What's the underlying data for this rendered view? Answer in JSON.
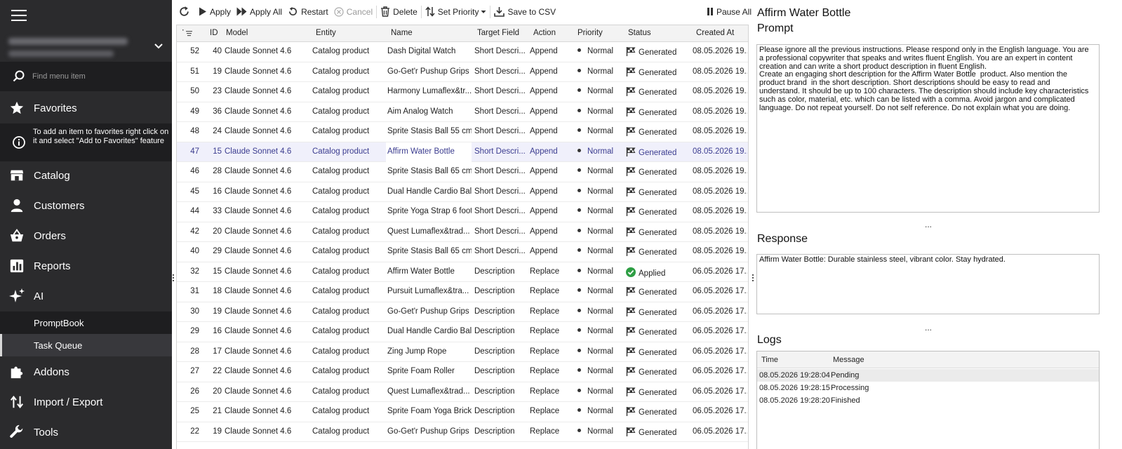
{
  "sidebar": {
    "search_placeholder": "Find menu item",
    "favorites_label": "Favorites",
    "favorites_hint": "To add an item to favorites right click on it and select \"Add to Favorites\" feature",
    "items": [
      {
        "label": "Catalog",
        "icon": "store-icon"
      },
      {
        "label": "Customers",
        "icon": "person-icon"
      },
      {
        "label": "Orders",
        "icon": "basket-icon"
      },
      {
        "label": "Reports",
        "icon": "bar-chart-icon"
      },
      {
        "label": "AI",
        "icon": "sparkle-icon"
      }
    ],
    "ai_subitems": [
      {
        "label": "PromptBook"
      },
      {
        "label": "Task Queue",
        "active": true
      }
    ],
    "bottom_items": [
      {
        "label": "Addons",
        "icon": "puzzle-icon"
      },
      {
        "label": "Import / Export",
        "icon": "import-export-icon"
      },
      {
        "label": "Tools",
        "icon": "wrench-icon"
      }
    ]
  },
  "toolbar": {
    "apply": "Apply",
    "apply_all": "Apply All",
    "restart": "Restart",
    "cancel": "Cancel",
    "delete": "Delete",
    "set_priority": "Set Priority",
    "save_csv": "Save to CSV",
    "pause_all": "Pause All"
  },
  "grid": {
    "columns": [
      "ID",
      "Model",
      "Entity",
      "Name",
      "Target Field",
      "Action",
      "Priority",
      "Status",
      "Created At"
    ],
    "rows": [
      {
        "num": "52",
        "id": "40",
        "model": "Claude Sonnet 4.6",
        "entity": "Catalog product",
        "name": "Dash Digital Watch",
        "field": "Short Descri...",
        "action": "Append",
        "priority": "Normal",
        "status": "Generated",
        "created": "08.05.2026 19..."
      },
      {
        "num": "51",
        "id": "19",
        "model": "Claude Sonnet 4.6",
        "entity": "Catalog product",
        "name": "Go-Get'r Pushup Grips",
        "field": "Short Descri...",
        "action": "Append",
        "priority": "Normal",
        "status": "Generated",
        "created": "08.05.2026 19..."
      },
      {
        "num": "50",
        "id": "23",
        "model": "Claude Sonnet 4.6",
        "entity": "Catalog product",
        "name": "Harmony Lumaflex&tr...",
        "field": "Short Descri...",
        "action": "Append",
        "priority": "Normal",
        "status": "Generated",
        "created": "08.05.2026 19..."
      },
      {
        "num": "49",
        "id": "36",
        "model": "Claude Sonnet 4.6",
        "entity": "Catalog product",
        "name": "Aim Analog Watch",
        "field": "Short Descri...",
        "action": "Append",
        "priority": "Normal",
        "status": "Generated",
        "created": "08.05.2026 19..."
      },
      {
        "num": "48",
        "id": "24",
        "model": "Claude Sonnet 4.6",
        "entity": "Catalog product",
        "name": "Sprite Stasis Ball 55 cm",
        "field": "Short Descri...",
        "action": "Append",
        "priority": "Normal",
        "status": "Generated",
        "created": "08.05.2026 19..."
      },
      {
        "num": "47",
        "id": "15",
        "model": "Claude Sonnet 4.6",
        "entity": "Catalog product",
        "name": "Affirm Water Bottle",
        "field": "Short Descri...",
        "action": "Append",
        "priority": "Normal",
        "status": "Generated",
        "created": "08.05.2026 19...",
        "selected": true
      },
      {
        "num": "46",
        "id": "28",
        "model": "Claude Sonnet 4.6",
        "entity": "Catalog product",
        "name": "Sprite Stasis Ball 65 cm",
        "field": "Short Descri...",
        "action": "Append",
        "priority": "Normal",
        "status": "Generated",
        "created": "08.05.2026 19..."
      },
      {
        "num": "45",
        "id": "16",
        "model": "Claude Sonnet 4.6",
        "entity": "Catalog product",
        "name": "Dual Handle Cardio Ball",
        "field": "Short Descri...",
        "action": "Append",
        "priority": "Normal",
        "status": "Generated",
        "created": "08.05.2026 19..."
      },
      {
        "num": "44",
        "id": "33",
        "model": "Claude Sonnet 4.6",
        "entity": "Catalog product",
        "name": "Sprite Yoga Strap 6 foot",
        "field": "Short Descri...",
        "action": "Append",
        "priority": "Normal",
        "status": "Generated",
        "created": "08.05.2026 19..."
      },
      {
        "num": "42",
        "id": "20",
        "model": "Claude Sonnet 4.6",
        "entity": "Catalog product",
        "name": "Quest Lumaflex&trad...",
        "field": "Short Descri...",
        "action": "Append",
        "priority": "Normal",
        "status": "Generated",
        "created": "08.05.2026 19..."
      },
      {
        "num": "40",
        "id": "29",
        "model": "Claude Sonnet 4.6",
        "entity": "Catalog product",
        "name": "Sprite Stasis Ball 65 cm",
        "field": "Short Descri...",
        "action": "Append",
        "priority": "Normal",
        "status": "Generated",
        "created": "08.05.2026 19..."
      },
      {
        "num": "32",
        "id": "15",
        "model": "Claude Sonnet 4.6",
        "entity": "Catalog product",
        "name": "Affirm Water Bottle",
        "field": "Description",
        "action": "Replace",
        "priority": "Normal",
        "status": "Applied",
        "created": "06.05.2026 17..."
      },
      {
        "num": "31",
        "id": "18",
        "model": "Claude Sonnet 4.6",
        "entity": "Catalog product",
        "name": "Pursuit Lumaflex&tra...",
        "field": "Description",
        "action": "Replace",
        "priority": "Normal",
        "status": "Generated",
        "created": "06.05.2026 17..."
      },
      {
        "num": "30",
        "id": "19",
        "model": "Claude Sonnet 4.6",
        "entity": "Catalog product",
        "name": "Go-Get'r Pushup Grips",
        "field": "Description",
        "action": "Replace",
        "priority": "Normal",
        "status": "Generated",
        "created": "06.05.2026 17..."
      },
      {
        "num": "29",
        "id": "16",
        "model": "Claude Sonnet 4.6",
        "entity": "Catalog product",
        "name": "Dual Handle Cardio Ball",
        "field": "Description",
        "action": "Replace",
        "priority": "Normal",
        "status": "Generated",
        "created": "06.05.2026 17..."
      },
      {
        "num": "28",
        "id": "17",
        "model": "Claude Sonnet 4.6",
        "entity": "Catalog product",
        "name": "Zing Jump Rope",
        "field": "Description",
        "action": "Replace",
        "priority": "Normal",
        "status": "Generated",
        "created": "06.05.2026 17..."
      },
      {
        "num": "27",
        "id": "22",
        "model": "Claude Sonnet 4.6",
        "entity": "Catalog product",
        "name": "Sprite Foam Roller",
        "field": "Description",
        "action": "Replace",
        "priority": "Normal",
        "status": "Generated",
        "created": "06.05.2026 17..."
      },
      {
        "num": "26",
        "id": "20",
        "model": "Claude Sonnet 4.6",
        "entity": "Catalog product",
        "name": "Quest Lumaflex&trad...",
        "field": "Description",
        "action": "Replace",
        "priority": "Normal",
        "status": "Generated",
        "created": "06.05.2026 17..."
      },
      {
        "num": "25",
        "id": "21",
        "model": "Claude Sonnet 4.6",
        "entity": "Catalog product",
        "name": "Sprite Foam Yoga Brick",
        "field": "Description",
        "action": "Replace",
        "priority": "Normal",
        "status": "Generated",
        "created": "06.05.2026 17..."
      },
      {
        "num": "22",
        "id": "19",
        "model": "Claude Sonnet 4.6",
        "entity": "Catalog product",
        "name": "Go-Get'r Pushup Grips",
        "field": "Description",
        "action": "Replace",
        "priority": "Normal",
        "status": "Generated",
        "created": "06.05.2026 17..."
      }
    ]
  },
  "detail": {
    "title": "Affirm Water Bottle",
    "prompt_label": "Prompt",
    "prompt_lines": [
      "Please ignore all the previous instructions. Please respond only in the English language. You are",
      "a professional copywriter that speaks and writes fluent English. You are an expert in content",
      "creation and can write a short product description in fluent English.",
      "Create an engaging short description for the Affirm Water Bottle  product. Also mention the",
      "product brand  in the short description. Short descriptions should be easy to read and",
      "understand. It should be up to 100 characters. The description should include key characteristics",
      "such as color, material, etc. which can be listed with a comma. Avoid jargon and complicated",
      "language. Do not repeat yourself. Do not self reference. Do not explain what you are doing."
    ],
    "response_label": "Response",
    "response": "Affirm Water Bottle: Durable stainless steel, vibrant color. Stay hydrated.",
    "ellipsis": "...",
    "logs_label": "Logs",
    "logs_columns": [
      "Time",
      "Message"
    ],
    "logs": [
      {
        "time": "08.05.2026 19:28:04",
        "message": "Pending"
      },
      {
        "time": "08.05.2026 19:28:15",
        "message": "Processing"
      },
      {
        "time": "08.05.2026 19:28:20",
        "message": "Finished"
      }
    ]
  },
  "colors": {
    "sidebar_bg": "#2b2b2d",
    "sidebar_dark": "#1e1e20",
    "selected_row_bg": "#f0f0fb",
    "selected_row_text": "#3b3c8f",
    "applied_green": "#2e9e44"
  }
}
